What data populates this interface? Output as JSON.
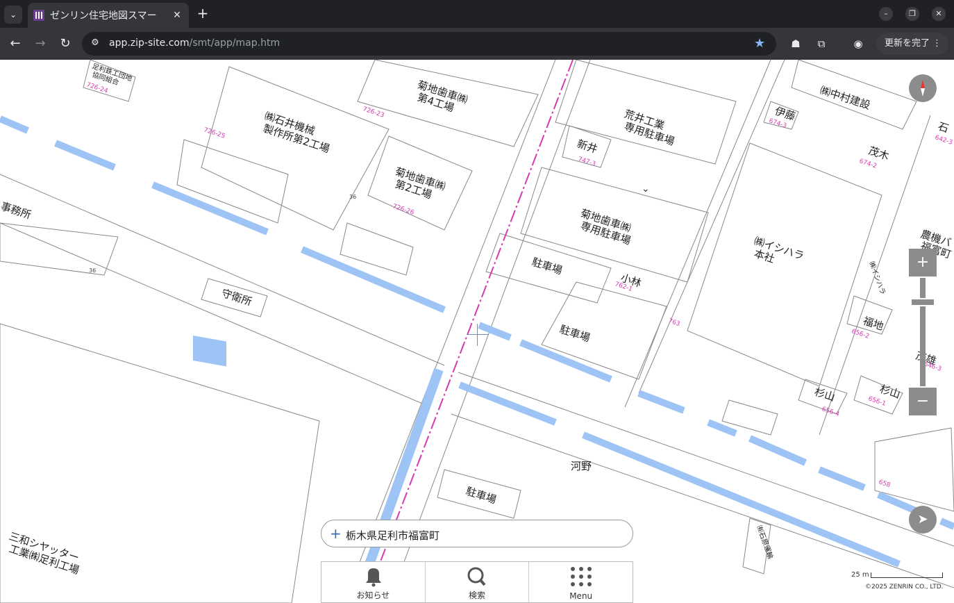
{
  "browser": {
    "tab_title": "ゼンリン住宅地図スマー",
    "url_host": "app.zip-site.com",
    "url_path": "/smt/app/map.htm",
    "update_label": "更新を完了"
  },
  "map": {
    "labels": {
      "ishii_factory_1": "㈱石井機械",
      "ishii_factory_2": "製作所第2工場",
      "kikuchi_4_1": "菊地歯車㈱",
      "kikuchi_4_2": "第4工場",
      "kikuchi_2_1": "菊地歯車㈱",
      "kikuchi_2_2": "第2工場",
      "arai_1": "荒井工業",
      "arai_2": "専用駐車場",
      "nakamura": "㈱中村建設",
      "ito": "伊藤",
      "shinai": "新井",
      "moki": "茂木",
      "kikuchi_p1": "菊地歯車㈱",
      "kikuchi_p2": "専用駐車場",
      "ishihara_1": "㈱イシハラ",
      "ishihara_2": "本社",
      "parking1": "駐車場",
      "parking2": "駐車場",
      "parking3": "駐車場",
      "kobayashi": "小林",
      "guard": "守衛所",
      "fukuchi": "福地",
      "sugiyama1": "杉山",
      "sugiyama2": "杉山",
      "kawano": "河野",
      "jimusho": "事務所",
      "sanwa_1": "三和シヤッター",
      "sanwa_2": "工業㈱足利工場",
      "nouki_1": "農機バ",
      "nouki_2": "福富町",
      "ishihara_unso": "㈲石原運輸",
      "ishi_v": "㈱イシハラ",
      "shigeo": "茂雄",
      "coop_1": "足利鉄工団地",
      "coop_2": "協同組合",
      "ishi_edge": "石"
    },
    "lot_numbers": {
      "l1": "726-24",
      "l2": "726-23",
      "l3": "726-25",
      "l4": "726-26",
      "l5": "674-3",
      "l6": "674-2",
      "l7": "747-3",
      "l8": "762-1",
      "l9": "763",
      "l10": "656-2",
      "l11": "656-4",
      "l12": "656-1",
      "l13": "658",
      "l14": "642-3",
      "l15": "646-3",
      "l16": "36",
      "l17": "36"
    },
    "address": "栃木県足利市福富町",
    "menu": {
      "notice": "お知らせ",
      "search": "検索",
      "menu": "Menu"
    },
    "scale_label": "25 m",
    "copyright": "©2025 ZENRIN CO., LTD."
  },
  "colors": {
    "road_blue": "#9ec4f5",
    "railway_line": "#d63ab0",
    "control_gray": "#8c8c8c"
  }
}
